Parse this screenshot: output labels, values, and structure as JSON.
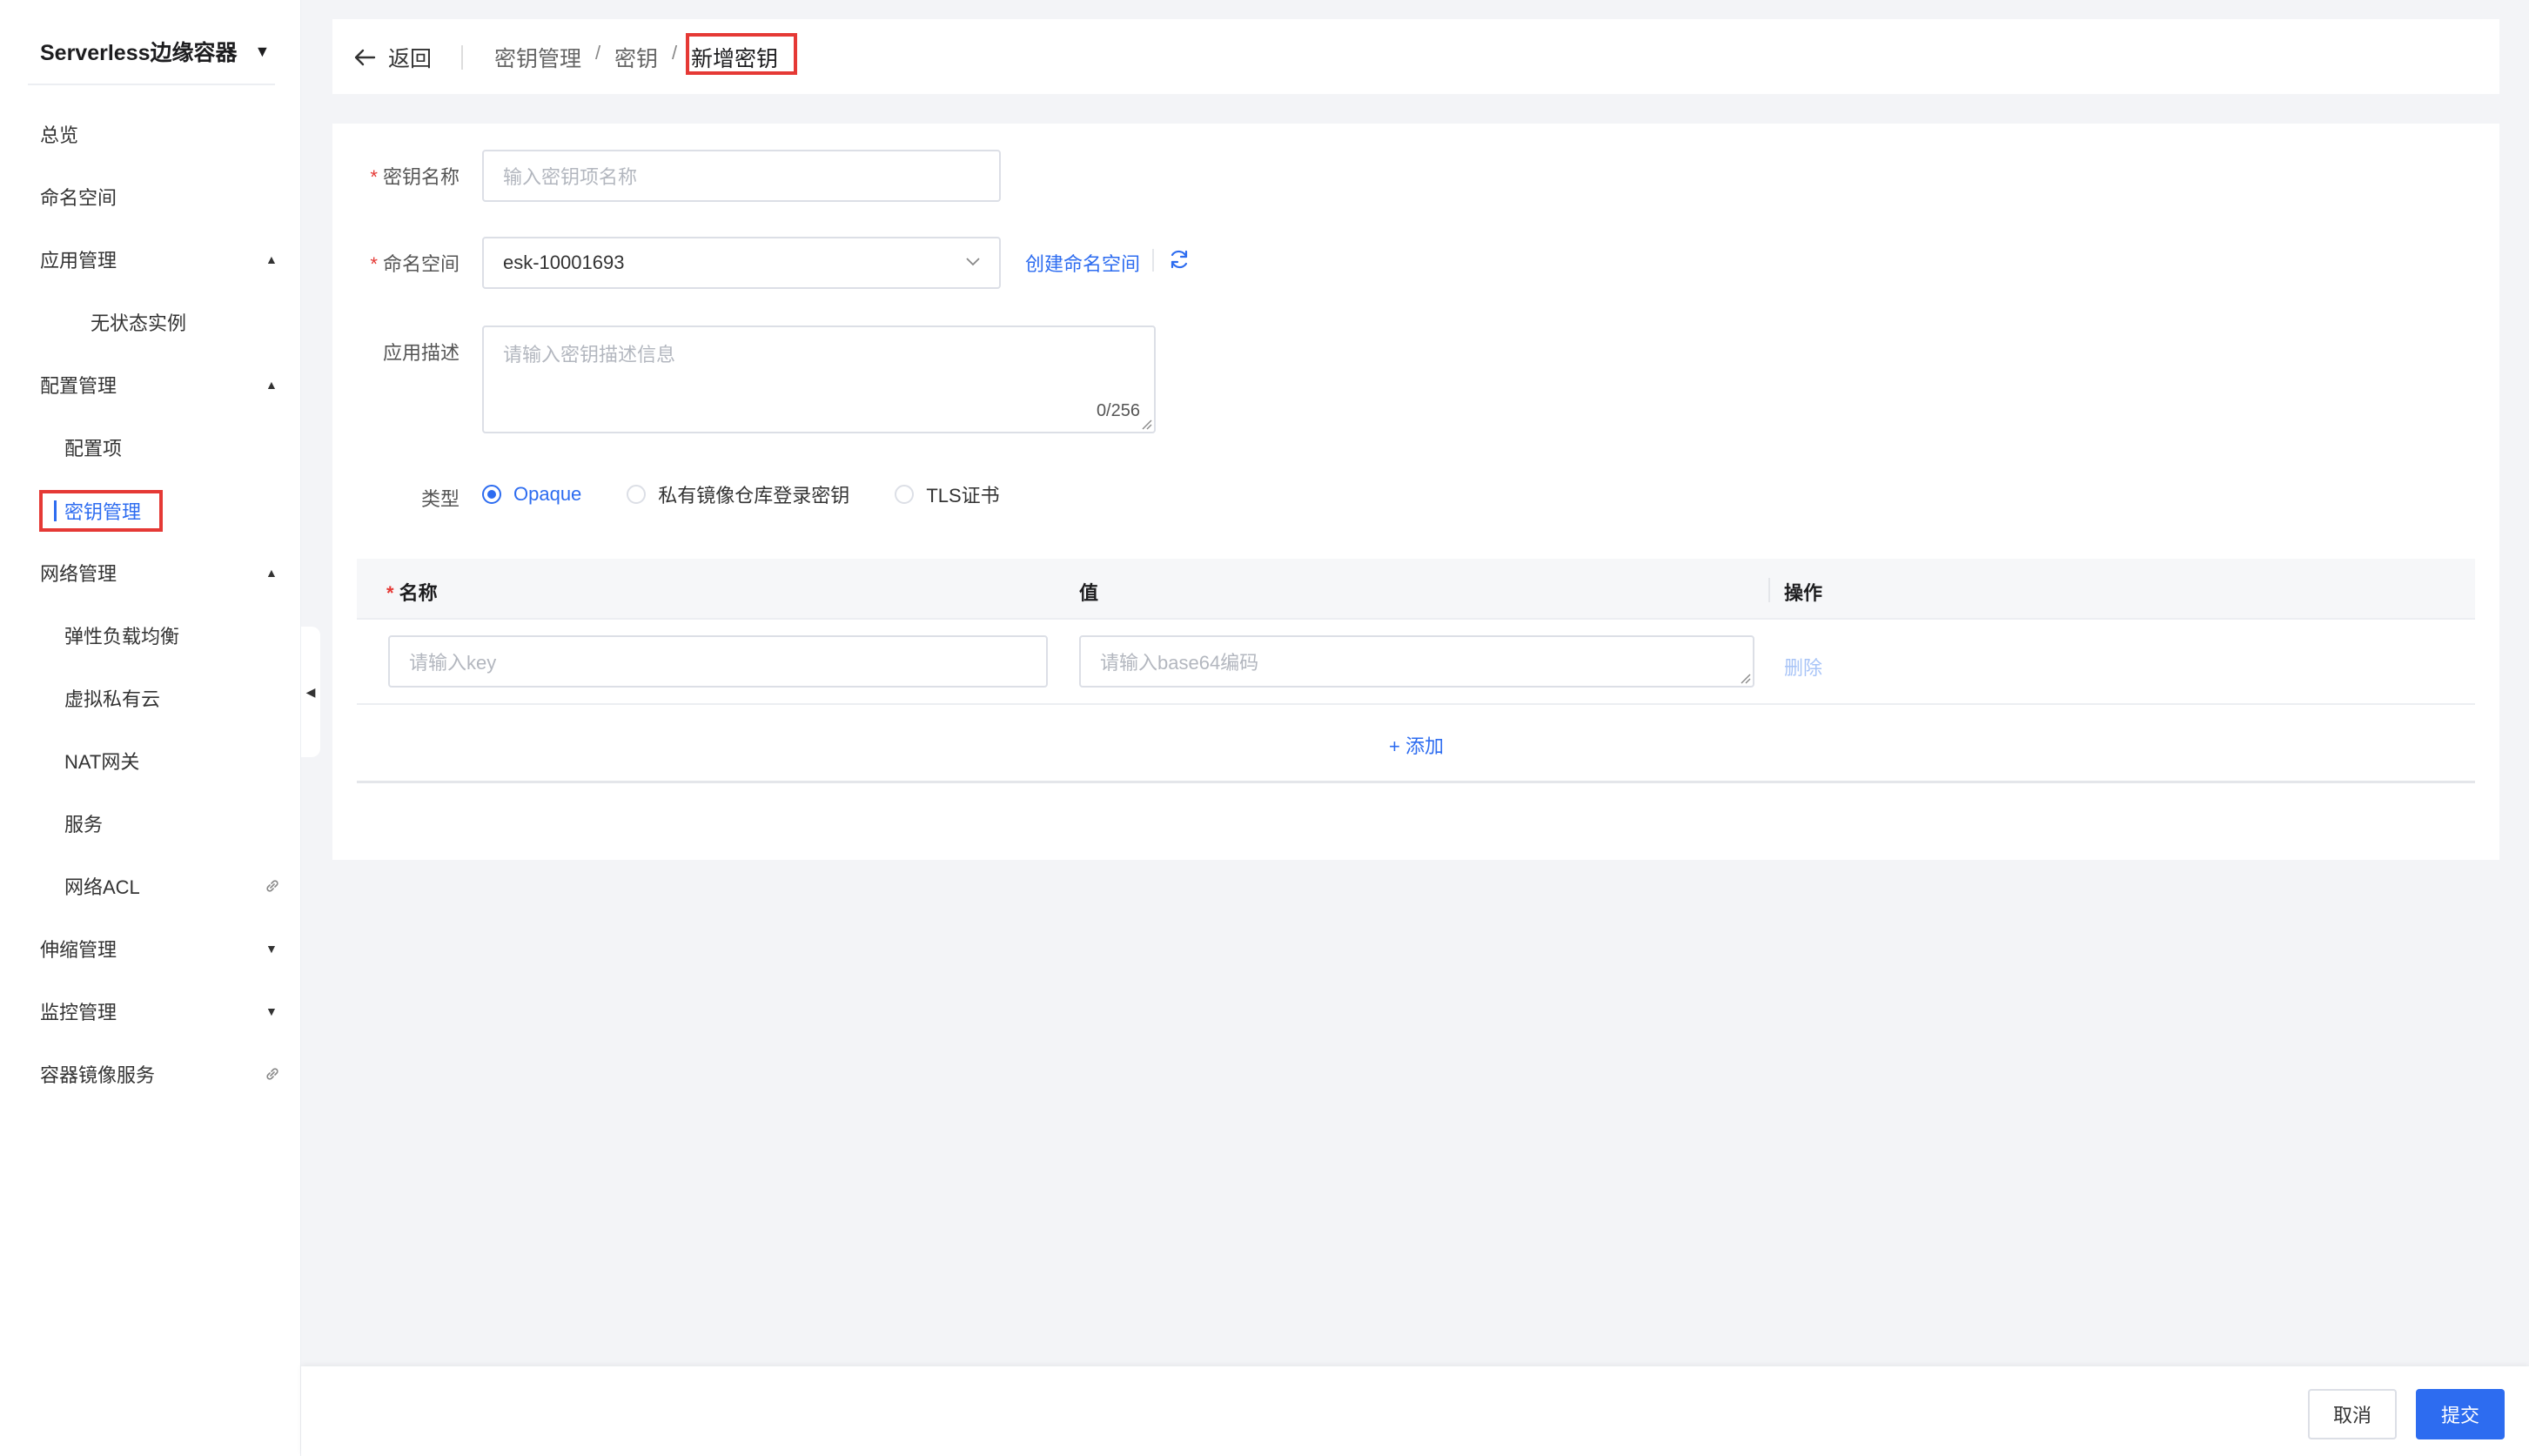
{
  "app": {
    "product_title": "Serverless边缘容器"
  },
  "sidebar": {
    "items": [
      {
        "label": "总览"
      },
      {
        "label": "命名空间"
      },
      {
        "label": "应用管理"
      },
      {
        "label": "无状态实例"
      },
      {
        "label": "配置管理"
      },
      {
        "label": "配置项"
      },
      {
        "label": "密钥管理"
      },
      {
        "label": "网络管理"
      },
      {
        "label": "弹性负载均衡"
      },
      {
        "label": "虚拟私有云"
      },
      {
        "label": "NAT网关"
      },
      {
        "label": "服务"
      },
      {
        "label": "网络ACL"
      },
      {
        "label": "伸缩管理"
      },
      {
        "label": "监控管理"
      },
      {
        "label": "容器镜像服务"
      }
    ]
  },
  "header": {
    "back_label": "返回",
    "breadcrumb": [
      "密钥管理",
      "密钥",
      "新增密钥"
    ]
  },
  "form": {
    "name_label": "密钥名称",
    "name_placeholder": "输入密钥项名称",
    "namespace_label": "命名空间",
    "namespace_value": "esk-10001693",
    "create_namespace_link": "创建命名空间",
    "desc_label": "应用描述",
    "desc_placeholder": "请输入密钥描述信息",
    "desc_counter": "0/256",
    "type_label": "类型",
    "type_options": [
      {
        "label": "Opaque",
        "selected": true
      },
      {
        "label": "私有镜像仓库登录密钥",
        "selected": false
      },
      {
        "label": "TLS证书",
        "selected": false
      }
    ]
  },
  "kv_table": {
    "col_name": "名称",
    "col_value": "值",
    "col_action": "操作",
    "key_placeholder": "请输入key",
    "value_placeholder": "请输入base64编码",
    "delete_label": "删除",
    "add_label": "+ 添加"
  },
  "footer": {
    "cancel_label": "取消",
    "submit_label": "提交"
  },
  "colors": {
    "accent": "#2d6cf0",
    "required": "#e53935",
    "highlight_box": "#e53935"
  }
}
